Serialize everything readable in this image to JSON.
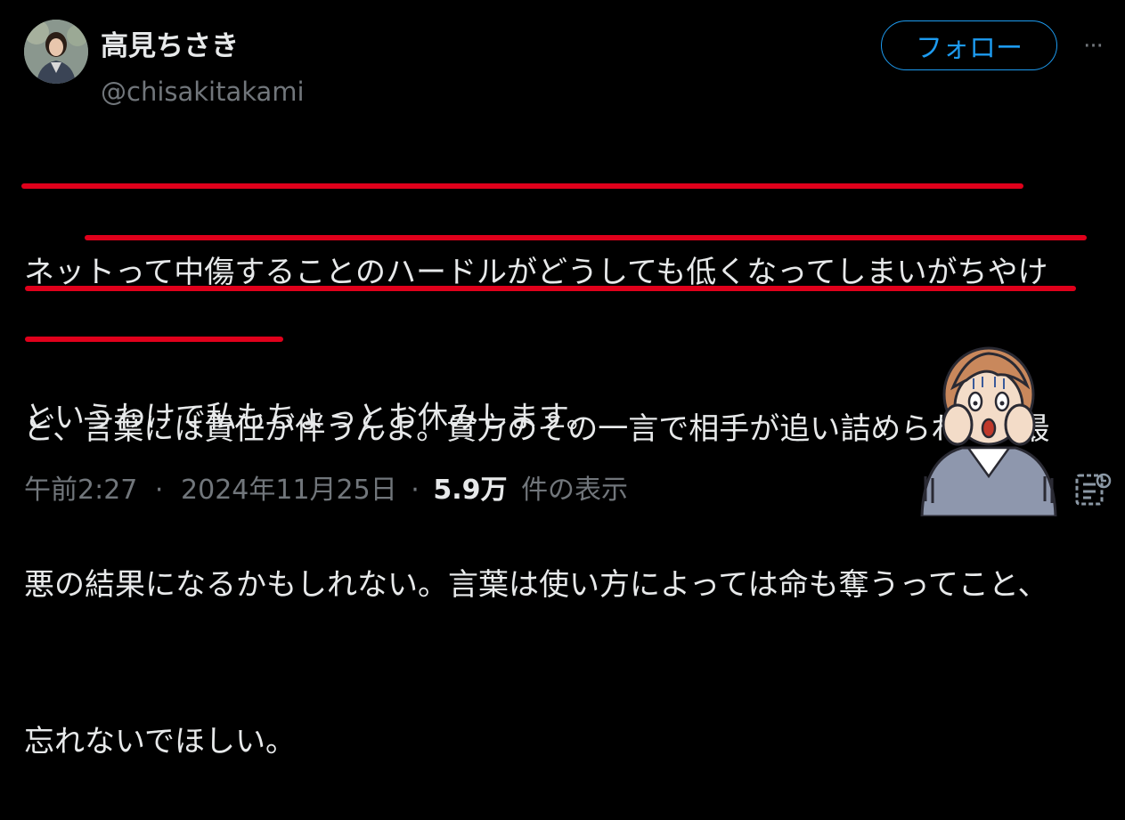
{
  "author": {
    "display_name": "高見ちさき",
    "handle": "@chisakitakami",
    "avatar_icon": "profile-photo"
  },
  "follow_button": {
    "label": "フォロー"
  },
  "more_button": {
    "label": "···",
    "icon": "more-options-icon"
  },
  "post": {
    "lines": [
      "ネットって中傷することのハードルがどうしても低くなってしまいがちやけ",
      "ど、言葉には責任が伴うんよ。貴方のその一言で相手が追い詰められて、最",
      "悪の結果になるかもしれない。言葉は使い方によっては命も奪うってこと、",
      "忘れないでほしい。"
    ],
    "second_paragraph": "というわけで私もちょっとお休みします。"
  },
  "meta": {
    "time": "午前2:27",
    "date": "2024年11月25日",
    "sep": "·",
    "views_count": "5.9万",
    "views_label": "件の表示"
  },
  "colors": {
    "accent": "#1d9bf0",
    "highlight_underline": "#e0001b",
    "background": "#000000",
    "secondary_text": "#71767b"
  },
  "decorations": {
    "illustration": "shocked-woman-illustration",
    "analytics_icon": "analytics-icon"
  }
}
